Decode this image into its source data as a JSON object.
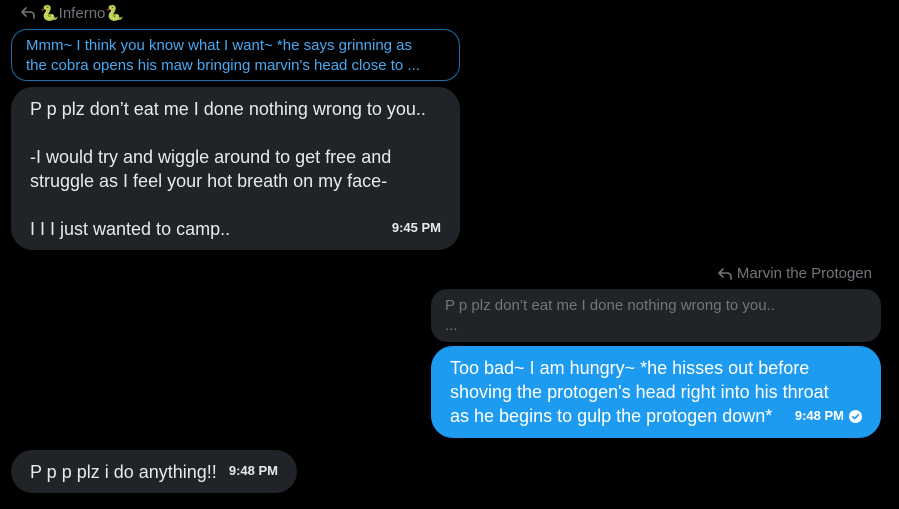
{
  "colors": {
    "background": "#000000",
    "received_bubble": "#202327",
    "sent_bubble": "#1d9bf0",
    "quote_outline": "#1d6ea8",
    "quote_text_blue": "#4aa8f0",
    "muted_text": "#71767b",
    "text": "#e7e9ea"
  },
  "messages": {
    "first_reply": {
      "author": "🐍Inferno🐍",
      "reply_icon": "reply-arrow-icon",
      "quote_line1": "Mmm~ I think you know what I want~ *he says grinning as",
      "quote_line2": "the cobra opens his maw bringing marvin's head close to ..."
    },
    "msg1": {
      "text": "P p plz don’t eat me I done nothing wrong to you..\n\n-I would try and wiggle around to get free and\nstruggle as I feel your hot breath on my face-\n\nI I I just wanted to camp..",
      "time": "9:45 PM"
    },
    "second_reply": {
      "author": "Marvin the Protogen",
      "reply_icon": "reply-arrow-icon",
      "quote_line1": "P p plz don’t eat me I done nothing wrong to you..",
      "quote_line2": "..."
    },
    "msg2": {
      "text": "Too bad~ I am hungry~ *he hisses out before\nshoving the protogen's head right into his throat\nas he begins to gulp the protogen down*",
      "time": "9:48 PM",
      "status_icon": "check-circle-icon"
    },
    "msg3": {
      "text": "P p p plz i do anything!!",
      "time": "9:48 PM"
    }
  }
}
